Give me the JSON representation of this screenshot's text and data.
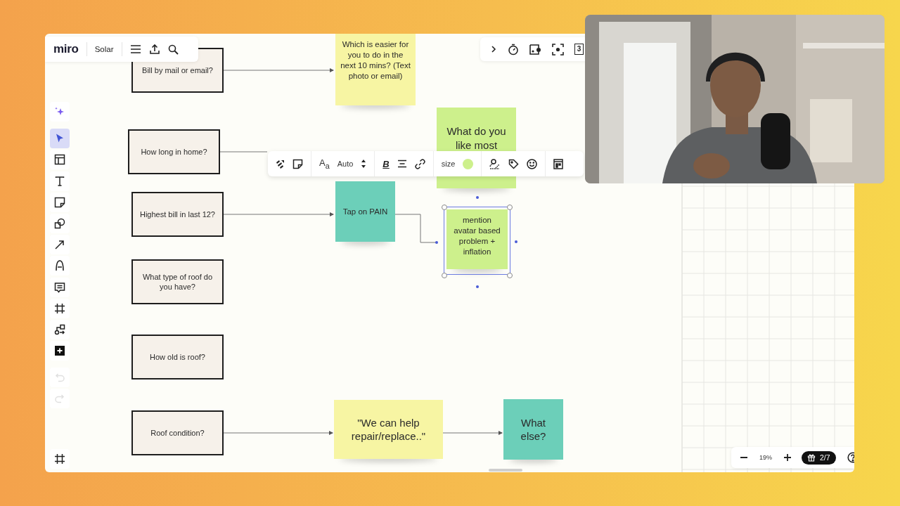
{
  "top_bar": {
    "logo": "miro",
    "board_name": "Solar"
  },
  "top_right_bar": {
    "calendar_day": "3"
  },
  "left_toolbar": {
    "tools": [
      {
        "kind": "sparkle",
        "selected": false,
        "disabled": false
      },
      {
        "kind": "select",
        "selected": true,
        "disabled": false
      },
      {
        "kind": "templates",
        "selected": false,
        "disabled": false
      },
      {
        "kind": "text",
        "selected": false,
        "disabled": false
      },
      {
        "kind": "sticky",
        "selected": false,
        "disabled": false
      },
      {
        "kind": "shapes",
        "selected": false,
        "disabled": false
      },
      {
        "kind": "arrow",
        "selected": false,
        "disabled": false
      },
      {
        "kind": "pen",
        "selected": false,
        "disabled": false
      },
      {
        "kind": "comment",
        "selected": false,
        "disabled": false
      },
      {
        "kind": "frame",
        "selected": false,
        "disabled": false
      },
      {
        "kind": "diagram",
        "selected": false,
        "disabled": false
      },
      {
        "kind": "add",
        "selected": false,
        "disabled": false
      },
      {
        "kind": "undo",
        "selected": false,
        "disabled": true
      },
      {
        "kind": "redo",
        "selected": false,
        "disabled": true
      },
      {
        "kind": "frames-panel",
        "selected": false,
        "disabled": false
      }
    ]
  },
  "shapes": [
    {
      "kind": "box",
      "text": "Bill by mail or email?"
    },
    {
      "kind": "box",
      "text": "How long in home?"
    },
    {
      "kind": "box",
      "text": "Highest bill in last 12?"
    },
    {
      "kind": "box",
      "text": "What type of roof do you have?"
    },
    {
      "kind": "box",
      "text": "How old is roof?"
    },
    {
      "kind": "box",
      "text": "Roof condition?"
    },
    {
      "kind": "sticky",
      "text": "Which is easier for you to do in the next 10 mins? (Text photo or email)",
      "color": "#f7f5a3",
      "selected": false
    },
    {
      "kind": "sticky",
      "text": "What do you like most",
      "color": "#cdf08c",
      "selected": false
    },
    {
      "kind": "sticky",
      "text": "Tap on PAIN",
      "color": "#6ccfb9",
      "selected": false
    },
    {
      "kind": "sticky",
      "text": "mention avatar based problem + inflation",
      "color": "#cdf08c",
      "selected": true
    },
    {
      "kind": "sticky",
      "text": "\"We can help repair/replace..\"",
      "color": "#f7f5a3",
      "selected": false
    },
    {
      "kind": "sticky",
      "text": "What else?",
      "color": "#6ccfb9",
      "selected": false
    }
  ],
  "context_toolbar": {
    "font_icon": "A$_{a}$",
    "font_size": "Auto",
    "bold_icon": "B",
    "size_label": "size",
    "color": "#cdf08c"
  },
  "zoom": {
    "reading": "19%",
    "page": "2/7"
  }
}
